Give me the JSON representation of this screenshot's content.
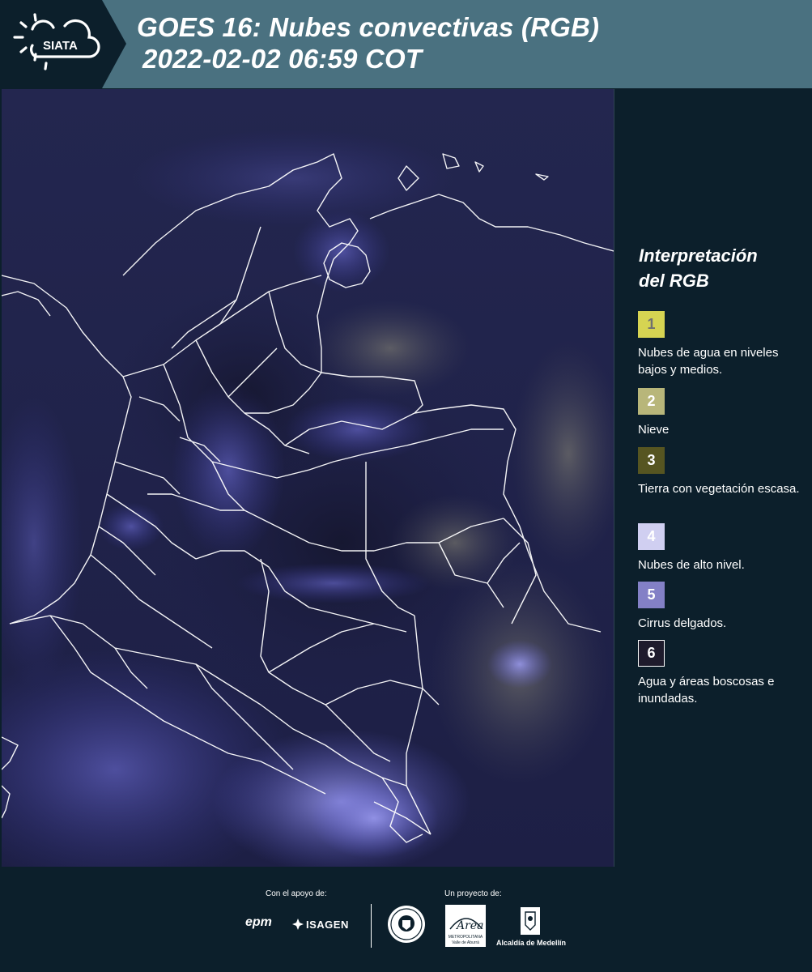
{
  "header": {
    "title_line1": "GOES 16: Nubes convectivas (RGB)",
    "title_line2": "2022-02-02 06:59 COT",
    "logo_text": "SIATA"
  },
  "legend": {
    "title_line1": "Interpretación",
    "title_line2": "del RGB",
    "items": [
      {
        "number": "1",
        "color": "#d6d452",
        "text_color": "#707070",
        "label": "Nubes de agua en niveles bajos y medios."
      },
      {
        "number": "2",
        "color": "#b8b67a",
        "text_color": "#ffffff",
        "label": "Nieve"
      },
      {
        "number": "3",
        "color": "#565521",
        "text_color": "#ffffff",
        "label": "Tierra con vegetación escasa."
      },
      {
        "number": "4",
        "color": "#d0cff1",
        "text_color": "#ffffff",
        "label": "Nubes de alto nivel."
      },
      {
        "number": "5",
        "color": "#8380c6",
        "text_color": "#ffffff",
        "label": "Cirrus delgados."
      },
      {
        "number": "6",
        "color": "#1e1b2c",
        "text_color": "#ffffff",
        "label": "Agua y áreas boscosas e inundadas."
      }
    ]
  },
  "footer": {
    "support_label": "Con el apoyo de:",
    "project_label": "Un proyecto de:",
    "epm": "epm",
    "isagen": "ISAGEN",
    "area_name": "Área",
    "area_sub1": "METROPOLITANA",
    "area_sub2": "Valle de Aburrá",
    "alcaldia": "Alcaldía de Medellín"
  },
  "colors": {
    "header_bg": "#4a7180",
    "page_bg": "#0c1f2b",
    "map_base": "#1d1f45"
  }
}
